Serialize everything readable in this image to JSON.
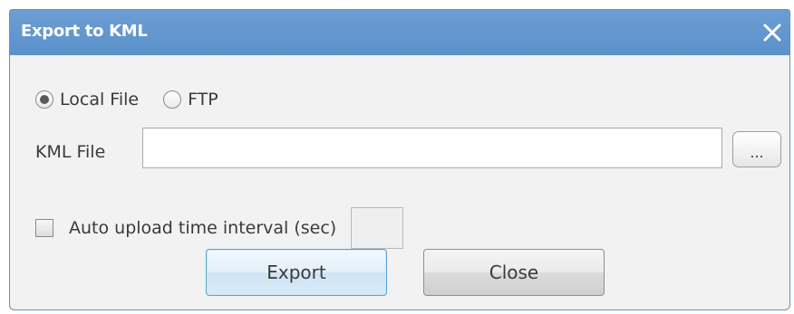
{
  "dialog": {
    "title": "Export to KML",
    "close_icon": "close-icon"
  },
  "destination": {
    "options": [
      "Local File",
      "FTP"
    ],
    "selected": "Local File"
  },
  "kml_file": {
    "label": "KML File",
    "value": "",
    "browse_label": "..."
  },
  "auto_upload": {
    "label": "Auto upload time interval (sec)",
    "checked": false,
    "interval_value": ""
  },
  "buttons": {
    "export_label": "Export",
    "close_label": "Close"
  },
  "colors": {
    "titlebar": "#5e93cc",
    "export_border": "#5aa2d8"
  }
}
